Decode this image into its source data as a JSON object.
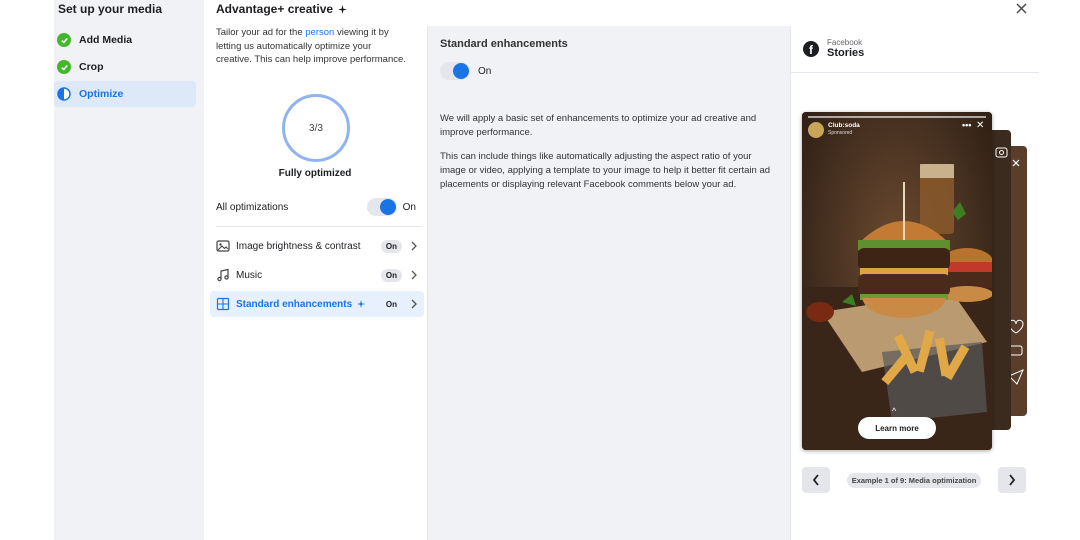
{
  "sidebar": {
    "title": "Set up your media",
    "steps": [
      {
        "label": "Add Media",
        "status": "done"
      },
      {
        "label": "Crop",
        "status": "done"
      },
      {
        "label": "Optimize",
        "status": "active"
      }
    ]
  },
  "advantage": {
    "title": "Advantage+ creative",
    "desc_before": "Tailor your ad for the ",
    "desc_link": "person",
    "desc_after": " viewing it by letting us automatically optimize your creative. This can help improve performance.",
    "progress_text": "3/3",
    "progress_fraction": 1.0,
    "progress_label": "Fully optimized",
    "all_optimizations_label": "All optimizations",
    "all_optimizations_state": "On",
    "options": [
      {
        "label": "Image brightness & contrast",
        "state": "On",
        "icon": "image-icon"
      },
      {
        "label": "Music",
        "state": "On",
        "icon": "music-note-icon"
      },
      {
        "label": "Standard enhancements",
        "state": "On",
        "icon": "enhancements-grid-icon",
        "selected": true
      }
    ]
  },
  "detail": {
    "title": "Standard enhancements",
    "toggle_state": "On",
    "paragraph1": "We will apply a basic set of enhancements to optimize your ad creative and improve performance.",
    "paragraph2": "This can include things like automatically adjusting the aspect ratio of your image or video, applying a template to your image to help it better fit certain ad placements or displaying relevant Facebook comments below your ad."
  },
  "preview": {
    "platform": "Facebook",
    "placement": "Stories",
    "story": {
      "brand": "Club:soda",
      "sponsored": "Sponsored",
      "cta": "Learn more"
    },
    "caption": "Example 1 of 9: Media optimization"
  },
  "colors": {
    "accent": "#1b74e4",
    "success": "#42b72a",
    "panel_bg": "#f0f2f5"
  }
}
